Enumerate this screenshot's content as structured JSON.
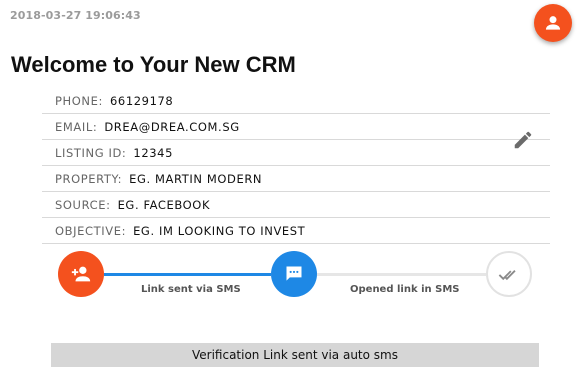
{
  "header": {
    "timestamp": "2018-03-27 19:06:43",
    "title": "Welcome to Your New CRM"
  },
  "info": [
    {
      "label": "PHONE:",
      "value": "66129178"
    },
    {
      "label": "EMAIL:",
      "value": "DREA@DREA.COM.SG"
    },
    {
      "label": "LISTING ID:",
      "value": "12345"
    },
    {
      "label": "PROPERTY:",
      "value": "EG. MARTIN MODERN"
    },
    {
      "label": "SOURCE:",
      "value": "EG. FACEBOOK"
    },
    {
      "label": "OBJECTIVE:",
      "value": "EG. IM LOOKING TO INVEST"
    }
  ],
  "steps": {
    "step1_label": "Link sent via SMS",
    "step2_label": "Opened link in SMS"
  },
  "status": {
    "text": "Verification Link sent via auto sms"
  },
  "colors": {
    "accent_orange": "#f4511e",
    "accent_blue": "#1e88e5",
    "status_bg": "#d6d6d6"
  },
  "icons": {
    "profile": "person-icon",
    "edit": "pencil-icon",
    "step1": "person-add-icon",
    "step2": "message-icon",
    "step3": "double-check-icon"
  }
}
